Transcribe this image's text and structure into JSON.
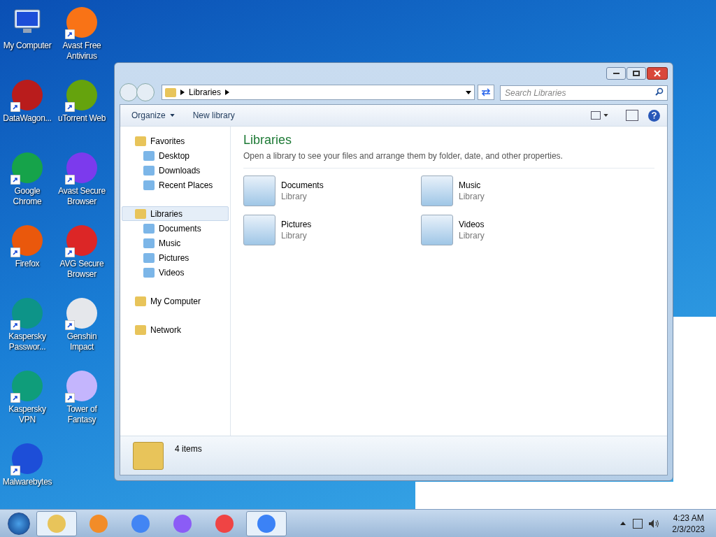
{
  "desktop_icons": [
    {
      "label": "My Computer",
      "shortcut": false
    },
    {
      "label": "Avast Free Antivirus",
      "shortcut": true
    },
    {
      "label": "DataWagon...",
      "shortcut": true
    },
    {
      "label": "uTorrent Web",
      "shortcut": true
    },
    {
      "label": "Google Chrome",
      "shortcut": true
    },
    {
      "label": "Avast Secure Browser",
      "shortcut": true
    },
    {
      "label": "Firefox",
      "shortcut": true
    },
    {
      "label": "AVG Secure Browser",
      "shortcut": true
    },
    {
      "label": "Kaspersky Passwor...",
      "shortcut": true
    },
    {
      "label": "Genshin Impact",
      "shortcut": true
    },
    {
      "label": "Kaspersky VPN",
      "shortcut": true
    },
    {
      "label": "Tower of Fantasy",
      "shortcut": true
    },
    {
      "label": "Malwarebytes",
      "shortcut": true
    }
  ],
  "window": {
    "breadcrumb": [
      "Libraries"
    ],
    "search": {
      "placeholder": "Search Libraries"
    },
    "toolbar": [
      "Organize",
      "New library"
    ],
    "nav": [
      {
        "label": "Favorites",
        "selected": false,
        "children": [
          {
            "label": "Desktop",
            "selected": false
          },
          {
            "label": "Downloads",
            "selected": false
          },
          {
            "label": "Recent Places",
            "selected": false
          }
        ]
      },
      {
        "label": "Libraries",
        "selected": true,
        "children": [
          {
            "label": "Documents",
            "selected": false
          },
          {
            "label": "Music",
            "selected": false
          },
          {
            "label": "Pictures",
            "selected": false
          },
          {
            "label": "Videos",
            "selected": false
          }
        ]
      },
      {
        "label": "My Computer",
        "selected": false
      },
      {
        "label": "Network",
        "selected": false
      }
    ],
    "heading": "Libraries",
    "description": "Open a library to see your files and arrange them by folder, date, and other properties.",
    "items": [
      {
        "name": "Documents",
        "type": "Library"
      },
      {
        "name": "Music",
        "type": "Library"
      },
      {
        "name": "Pictures",
        "type": "Library"
      },
      {
        "name": "Videos",
        "type": "Library"
      }
    ],
    "status": "4 items"
  },
  "taskbar": {
    "apps": [
      {
        "selected": true
      },
      {
        "selected": false
      },
      {
        "selected": false
      },
      {
        "selected": false
      },
      {
        "selected": false
      },
      {
        "selected": true
      }
    ],
    "time": "4:23 AM",
    "date": "2/3/2023"
  }
}
